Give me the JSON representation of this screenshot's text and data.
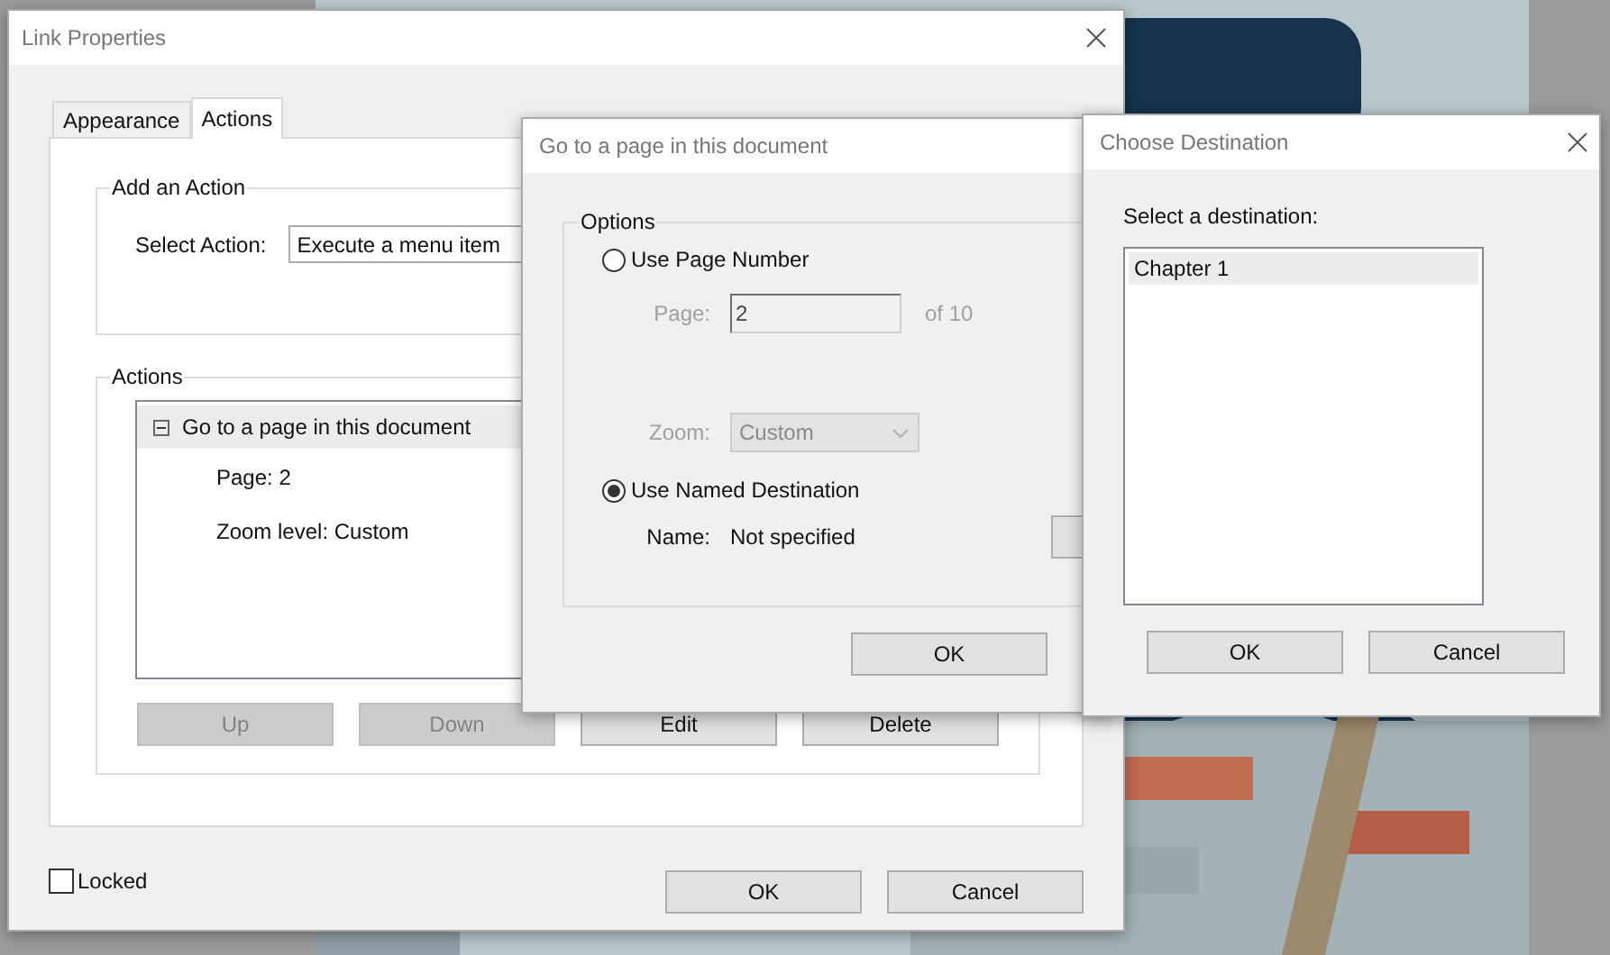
{
  "link_properties": {
    "title": "Link Properties",
    "tabs": [
      {
        "label": "Appearance",
        "selected": false
      },
      {
        "label": "Actions",
        "selected": true
      }
    ],
    "add_action": {
      "legend": "Add an Action",
      "select_label": "Select Action:",
      "select_value": "Execute a menu item"
    },
    "actions": {
      "legend": "Actions",
      "items": [
        {
          "label": "Go to a page in this document",
          "expanded": true,
          "children": [
            {
              "label": "Page: 2"
            },
            {
              "label": "Zoom level: Custom"
            }
          ]
        }
      ],
      "buttons": [
        {
          "label": "Up",
          "disabled": true
        },
        {
          "label": "Down",
          "disabled": true
        },
        {
          "label": "Edit",
          "disabled": false
        },
        {
          "label": "Delete",
          "disabled": false
        }
      ]
    },
    "locked": {
      "label": "Locked",
      "checked": false
    },
    "buttons": [
      "OK",
      "Cancel"
    ]
  },
  "goto_dialog": {
    "title": "Go to a page in this document",
    "legend": "Options",
    "use_page_number": {
      "label": "Use Page Number",
      "selected": false
    },
    "page": {
      "label": "Page:",
      "value": "2",
      "suffix": "of 10",
      "disabled": true
    },
    "zoom": {
      "label": "Zoom:",
      "value": "Custom",
      "disabled": true
    },
    "use_named_destination": {
      "label": "Use Named Destination",
      "selected": true
    },
    "name": {
      "label": "Name:",
      "value": "Not specified"
    },
    "buttons": [
      "OK"
    ]
  },
  "choose_destination": {
    "title": "Choose Destination",
    "prompt": "Select a destination:",
    "items": [
      {
        "label": "Chapter 1",
        "selected": true
      }
    ],
    "buttons": [
      "OK",
      "Cancel"
    ]
  }
}
